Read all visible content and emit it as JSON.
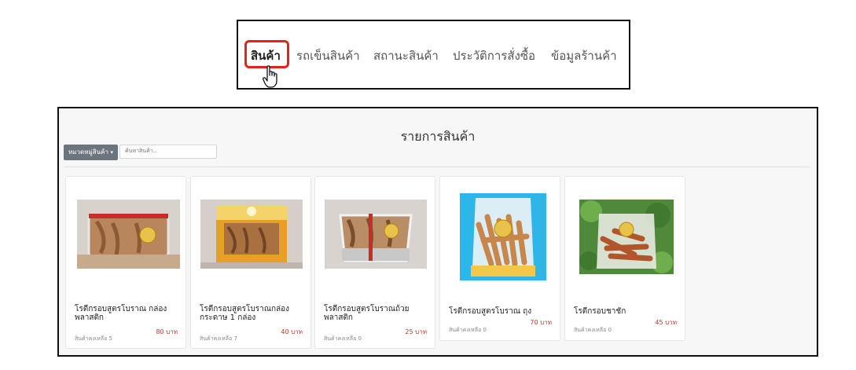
{
  "nav": {
    "items": [
      "สินค้า",
      "รถเข็นสินค้า",
      "สถานะสินค้า",
      "ประวัติการสั่งซื้อ",
      "ข้อมูลร้านค้า"
    ]
  },
  "panel": {
    "title": "รายการสินค้า",
    "category_button": "หมวดหมู่สินค้า",
    "search_placeholder": "ค้นหาสินค้า..."
  },
  "products": [
    {
      "name": "โรตีกรอบสูตรโบราณ กล่องพลาสติก",
      "price": "80 บาท",
      "stock": "สินค้าคงเหลือ 5"
    },
    {
      "name": "โรตีกรอบสูตรโบราณกล่องกระดาษ 1 กล่อง",
      "price": "40 บาท",
      "stock": "สินค้าคงเหลือ 7"
    },
    {
      "name": "โรตีกรอบสูตรโบราณถ้วยพลาสติก",
      "price": "25 บาท",
      "stock": "สินค้าคงเหลือ 0"
    },
    {
      "name": "โรตีกรอบสูตรโบราณ ถุง",
      "price": "70 บาท",
      "stock": "สินค้าคงเหลือ 0"
    },
    {
      "name": "โรตีกรอบชาชัก",
      "price": "45 บาท",
      "stock": "สินค้าคงเหลือ 0"
    }
  ],
  "colors": {
    "price": "#c0392b",
    "highlight": "#e3231e",
    "category_button": "#6c757d"
  },
  "icons": {
    "cursor": "hand-pointer-icon",
    "category_caret": "caret-down-icon"
  }
}
